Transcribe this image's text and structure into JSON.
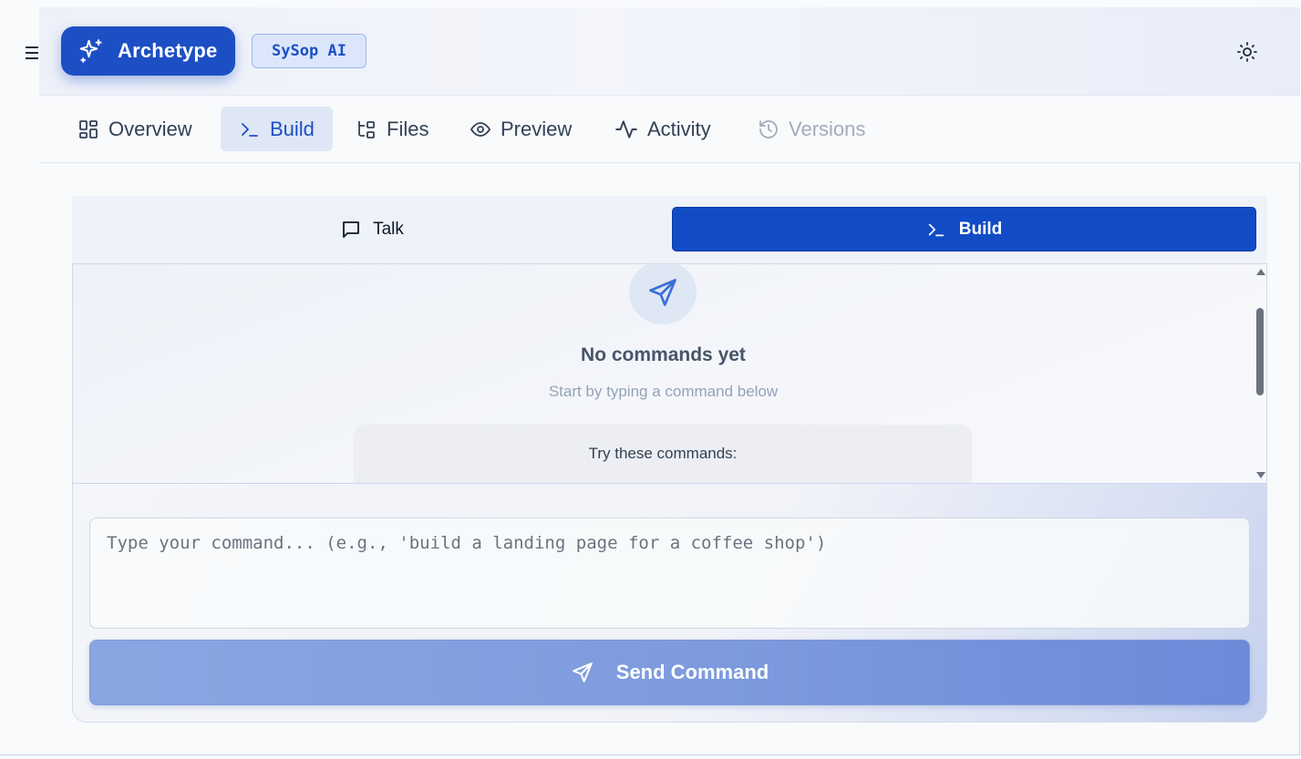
{
  "app": {
    "brand_label": "Archetype",
    "badge_label": "SySop AI",
    "brand_color": "#1d4fc4"
  },
  "nav": {
    "tabs": [
      {
        "label": "Overview",
        "icon": "layout-grid-icon",
        "state": "default"
      },
      {
        "label": "Build",
        "icon": "terminal-icon",
        "state": "active"
      },
      {
        "label": "Files",
        "icon": "file-tree-icon",
        "state": "default"
      },
      {
        "label": "Preview",
        "icon": "eye-icon",
        "state": "default"
      },
      {
        "label": "Activity",
        "icon": "activity-pulse-icon",
        "state": "default"
      },
      {
        "label": "Versions",
        "icon": "history-icon",
        "state": "disabled"
      }
    ]
  },
  "mode": {
    "talk_label": "Talk",
    "build_label": "Build",
    "selected": "Build"
  },
  "history": {
    "empty_title": "No commands yet",
    "empty_subtitle": "Start by typing a command below",
    "suggestions_title": "Try these commands:"
  },
  "composer": {
    "placeholder": "Type your command... (e.g., 'build a landing page for a coffee shop')",
    "value": "",
    "send_label": "Send Command"
  }
}
